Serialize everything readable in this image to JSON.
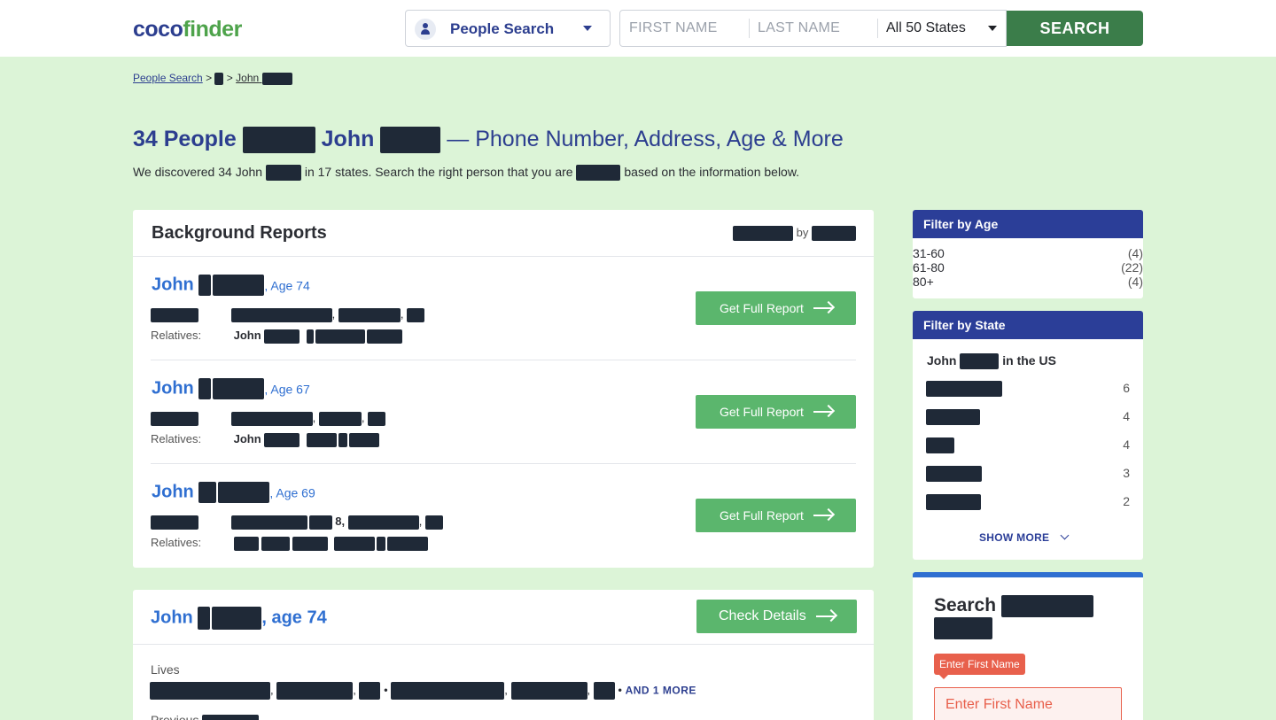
{
  "header": {
    "logo_part1": "coco",
    "logo_part2": "finder",
    "search_type": "People Search",
    "first_name_placeholder": "FIRST NAME",
    "last_name_placeholder": "LAST NAME",
    "state": "All 50 States",
    "search_label": "SEARCH"
  },
  "breadcrumb": {
    "root": "People Search",
    "sep": ">",
    "leaf": "John"
  },
  "page": {
    "title_prefix": "34 People",
    "title_name": "John",
    "title_suffix": "— Phone Number, Address, Age & More",
    "sub_part1": "We discovered 34 John",
    "sub_part2": "in 17 states. Search the right person that you are",
    "sub_part3": "based on the information below."
  },
  "reports": {
    "title": "Background Reports",
    "by_label": "by",
    "relatives_label": "Relatives:",
    "button_label": "Get Full Report",
    "items": [
      {
        "first": "John",
        "age": "Age 74",
        "rel_first": "John"
      },
      {
        "first": "John",
        "age": "Age 67",
        "rel_first": "John"
      },
      {
        "first": "John",
        "age": "Age 69",
        "addr_frag": "8,"
      }
    ]
  },
  "detail": {
    "name": "John",
    "age": ", age 74",
    "button_label": "Check Details",
    "lives_label": "Lives",
    "more_label": "AND 1 MORE",
    "previous_label": "Previous"
  },
  "filter_age": {
    "title": "Filter by Age",
    "items": [
      {
        "range": "31-60",
        "count": "(4)"
      },
      {
        "range": "61-80",
        "count": "(22)"
      },
      {
        "range": "80+",
        "count": "(4)"
      }
    ]
  },
  "filter_state": {
    "title": "Filter by State",
    "us_prefix": "John",
    "us_suffix": "in the US",
    "counts": [
      "6",
      "4",
      "4",
      "3",
      "2"
    ],
    "show_more": "SHOW MORE"
  },
  "search_side": {
    "title": "Search",
    "tooltip": "Enter First Name",
    "placeholder": "Enter First Name"
  }
}
